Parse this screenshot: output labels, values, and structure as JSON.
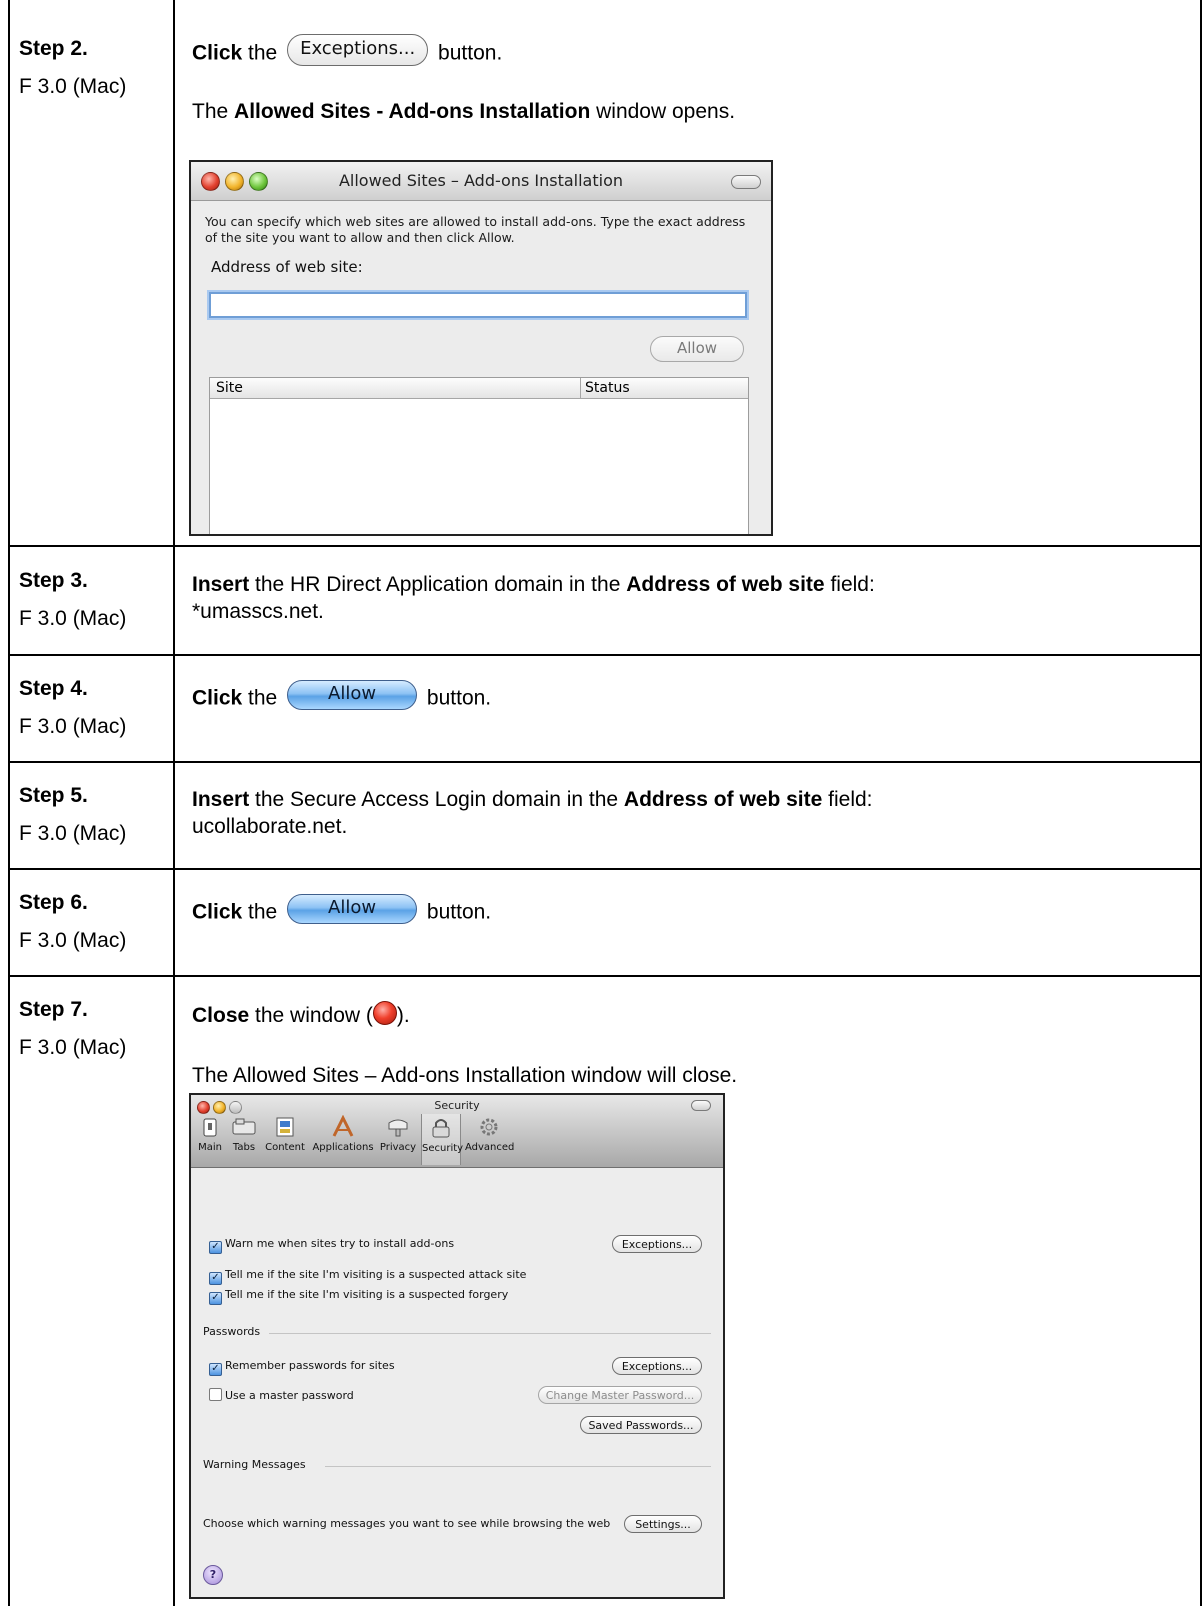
{
  "steps": [
    {
      "label": "Step 2.",
      "version": "F 3.0 (Mac)"
    },
    {
      "label": "Step 3.",
      "version": "F 3.0 (Mac)"
    },
    {
      "label": "Step 4.",
      "version": "F 3.0 (Mac)"
    },
    {
      "label": "Step 5.",
      "version": "F 3.0 (Mac)"
    },
    {
      "label": "Step 6.",
      "version": "F 3.0 (Mac)"
    },
    {
      "label": "Step 7.",
      "version": "F 3.0 (Mac)"
    }
  ],
  "step2": {
    "click_word": "Click",
    "the": " the ",
    "button_label": "Exceptions...",
    "after": " button.",
    "line2_pre": "The ",
    "line2_bold": "Allowed Sites - Add-ons Installation",
    "line2_post": " window opens."
  },
  "allowed_window": {
    "title": "Allowed Sites – Add-ons Installation",
    "description": "You can specify which web sites are allowed to install add-ons. Type the exact address of the site you want to allow and then click Allow.",
    "address_label": "Address of web site:",
    "address_value": "",
    "allow_button": "Allow",
    "columns": [
      "Site",
      "Status"
    ]
  },
  "step3": {
    "verb": "Insert",
    "mid": " the HR Direct Application domain in the ",
    "field": "Address of web site",
    "post": " field:",
    "line2": "*umasscs.net."
  },
  "step4": {
    "verb": "Click",
    "the": " the ",
    "button_label": "Allow",
    "after": " button."
  },
  "step5": {
    "verb": "Insert",
    "mid": " the Secure Access Login domain in the ",
    "field": "Address of web site",
    "post": " field:",
    "line2": "ucollaborate.net."
  },
  "step6": {
    "verb": "Click",
    "the": " the ",
    "button_label": "Allow",
    "after": " button."
  },
  "step7": {
    "verb": "Close",
    "mid": " the window (",
    "post": ").",
    "line2": "The Allowed Sites – Add-ons Installation window will close."
  },
  "security_window": {
    "title": "Security",
    "toolbar": [
      "Main",
      "Tabs",
      "Content",
      "Applications",
      "Privacy",
      "Security",
      "Advanced"
    ],
    "selected_tab": "Security",
    "warn_addons": {
      "label": "Warn me when sites try to install add-ons",
      "checked": true
    },
    "exceptions1": "Exceptions...",
    "attack": {
      "label": "Tell me if the site I'm visiting is a suspected attack site",
      "checked": true
    },
    "forgery": {
      "label": "Tell me if the site I'm visiting is a suspected forgery",
      "checked": true
    },
    "passwords_heading": "Passwords",
    "remember": {
      "label": "Remember passwords for sites",
      "checked": true
    },
    "exceptions2": "Exceptions...",
    "master": {
      "label": "Use a master password",
      "checked": false
    },
    "change_master": "Change Master Password...",
    "saved_passwords": "Saved Passwords...",
    "warning_heading": "Warning Messages",
    "warning_text": "Choose which warning messages you want to see while browsing the web",
    "settings": "Settings...",
    "help": "?"
  }
}
